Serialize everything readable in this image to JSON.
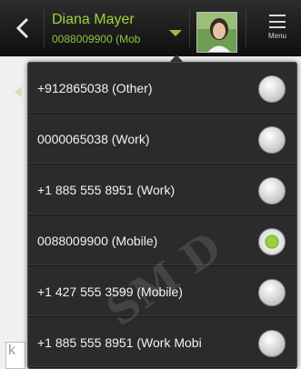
{
  "header": {
    "contact_name": "Diana Mayer",
    "contact_number": "0088009900 (Mob",
    "menu_label": "Menu"
  },
  "background": {
    "input_text": "k"
  },
  "popup": {
    "options": [
      {
        "label": "+912865038 (Other)",
        "selected": false
      },
      {
        "label": "0000065038 (Work)",
        "selected": false
      },
      {
        "label": "+1 885 555 8951 (Work)",
        "selected": false
      },
      {
        "label": "0088009900 (Mobile)",
        "selected": true
      },
      {
        "label": "+1 427 555 3599 (Mobile)",
        "selected": false
      },
      {
        "label": "+1 885 555 8951 (Work Mobi",
        "selected": false
      }
    ]
  },
  "watermark": "SM D",
  "colors": {
    "accent": "#8cc63a",
    "popup_bg": "#2b2b2b",
    "topbar_bg": "#1a1a1a"
  },
  "icons": {
    "back": "chevron-left-icon",
    "dropdown": "dropdown-arrow-icon",
    "menu": "menu-lines-icon",
    "radio": "radio-button-icon"
  }
}
